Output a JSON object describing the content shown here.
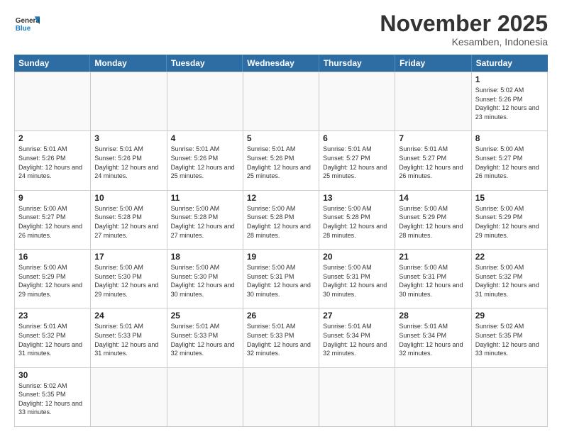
{
  "header": {
    "logo_general": "General",
    "logo_blue": "Blue",
    "month_title": "November 2025",
    "location": "Kesamben, Indonesia"
  },
  "days_of_week": [
    "Sunday",
    "Monday",
    "Tuesday",
    "Wednesday",
    "Thursday",
    "Friday",
    "Saturday"
  ],
  "cells": [
    {
      "day": "",
      "empty": true
    },
    {
      "day": "",
      "empty": true
    },
    {
      "day": "",
      "empty": true
    },
    {
      "day": "",
      "empty": true
    },
    {
      "day": "",
      "empty": true
    },
    {
      "day": "",
      "empty": true
    },
    {
      "day": "1",
      "sunrise": "5:02 AM",
      "sunset": "5:26 PM",
      "daylight": "12 hours and 23 minutes."
    },
    {
      "day": "2",
      "sunrise": "5:01 AM",
      "sunset": "5:26 PM",
      "daylight": "12 hours and 24 minutes."
    },
    {
      "day": "3",
      "sunrise": "5:01 AM",
      "sunset": "5:26 PM",
      "daylight": "12 hours and 24 minutes."
    },
    {
      "day": "4",
      "sunrise": "5:01 AM",
      "sunset": "5:26 PM",
      "daylight": "12 hours and 25 minutes."
    },
    {
      "day": "5",
      "sunrise": "5:01 AM",
      "sunset": "5:26 PM",
      "daylight": "12 hours and 25 minutes."
    },
    {
      "day": "6",
      "sunrise": "5:01 AM",
      "sunset": "5:27 PM",
      "daylight": "12 hours and 25 minutes."
    },
    {
      "day": "7",
      "sunrise": "5:01 AM",
      "sunset": "5:27 PM",
      "daylight": "12 hours and 26 minutes."
    },
    {
      "day": "8",
      "sunrise": "5:00 AM",
      "sunset": "5:27 PM",
      "daylight": "12 hours and 26 minutes."
    },
    {
      "day": "9",
      "sunrise": "5:00 AM",
      "sunset": "5:27 PM",
      "daylight": "12 hours and 26 minutes."
    },
    {
      "day": "10",
      "sunrise": "5:00 AM",
      "sunset": "5:28 PM",
      "daylight": "12 hours and 27 minutes."
    },
    {
      "day": "11",
      "sunrise": "5:00 AM",
      "sunset": "5:28 PM",
      "daylight": "12 hours and 27 minutes."
    },
    {
      "day": "12",
      "sunrise": "5:00 AM",
      "sunset": "5:28 PM",
      "daylight": "12 hours and 28 minutes."
    },
    {
      "day": "13",
      "sunrise": "5:00 AM",
      "sunset": "5:28 PM",
      "daylight": "12 hours and 28 minutes."
    },
    {
      "day": "14",
      "sunrise": "5:00 AM",
      "sunset": "5:29 PM",
      "daylight": "12 hours and 28 minutes."
    },
    {
      "day": "15",
      "sunrise": "5:00 AM",
      "sunset": "5:29 PM",
      "daylight": "12 hours and 29 minutes."
    },
    {
      "day": "16",
      "sunrise": "5:00 AM",
      "sunset": "5:29 PM",
      "daylight": "12 hours and 29 minutes."
    },
    {
      "day": "17",
      "sunrise": "5:00 AM",
      "sunset": "5:30 PM",
      "daylight": "12 hours and 29 minutes."
    },
    {
      "day": "18",
      "sunrise": "5:00 AM",
      "sunset": "5:30 PM",
      "daylight": "12 hours and 30 minutes."
    },
    {
      "day": "19",
      "sunrise": "5:00 AM",
      "sunset": "5:31 PM",
      "daylight": "12 hours and 30 minutes."
    },
    {
      "day": "20",
      "sunrise": "5:00 AM",
      "sunset": "5:31 PM",
      "daylight": "12 hours and 30 minutes."
    },
    {
      "day": "21",
      "sunrise": "5:00 AM",
      "sunset": "5:31 PM",
      "daylight": "12 hours and 30 minutes."
    },
    {
      "day": "22",
      "sunrise": "5:00 AM",
      "sunset": "5:32 PM",
      "daylight": "12 hours and 31 minutes."
    },
    {
      "day": "23",
      "sunrise": "5:01 AM",
      "sunset": "5:32 PM",
      "daylight": "12 hours and 31 minutes."
    },
    {
      "day": "24",
      "sunrise": "5:01 AM",
      "sunset": "5:33 PM",
      "daylight": "12 hours and 31 minutes."
    },
    {
      "day": "25",
      "sunrise": "5:01 AM",
      "sunset": "5:33 PM",
      "daylight": "12 hours and 32 minutes."
    },
    {
      "day": "26",
      "sunrise": "5:01 AM",
      "sunset": "5:33 PM",
      "daylight": "12 hours and 32 minutes."
    },
    {
      "day": "27",
      "sunrise": "5:01 AM",
      "sunset": "5:34 PM",
      "daylight": "12 hours and 32 minutes."
    },
    {
      "day": "28",
      "sunrise": "5:01 AM",
      "sunset": "5:34 PM",
      "daylight": "12 hours and 32 minutes."
    },
    {
      "day": "29",
      "sunrise": "5:02 AM",
      "sunset": "5:35 PM",
      "daylight": "12 hours and 33 minutes."
    },
    {
      "day": "30",
      "sunrise": "5:02 AM",
      "sunset": "5:35 PM",
      "daylight": "12 hours and 33 minutes."
    },
    {
      "day": "",
      "empty": true
    },
    {
      "day": "",
      "empty": true
    },
    {
      "day": "",
      "empty": true
    },
    {
      "day": "",
      "empty": true
    },
    {
      "day": "",
      "empty": true
    },
    {
      "day": "",
      "empty": true
    }
  ]
}
